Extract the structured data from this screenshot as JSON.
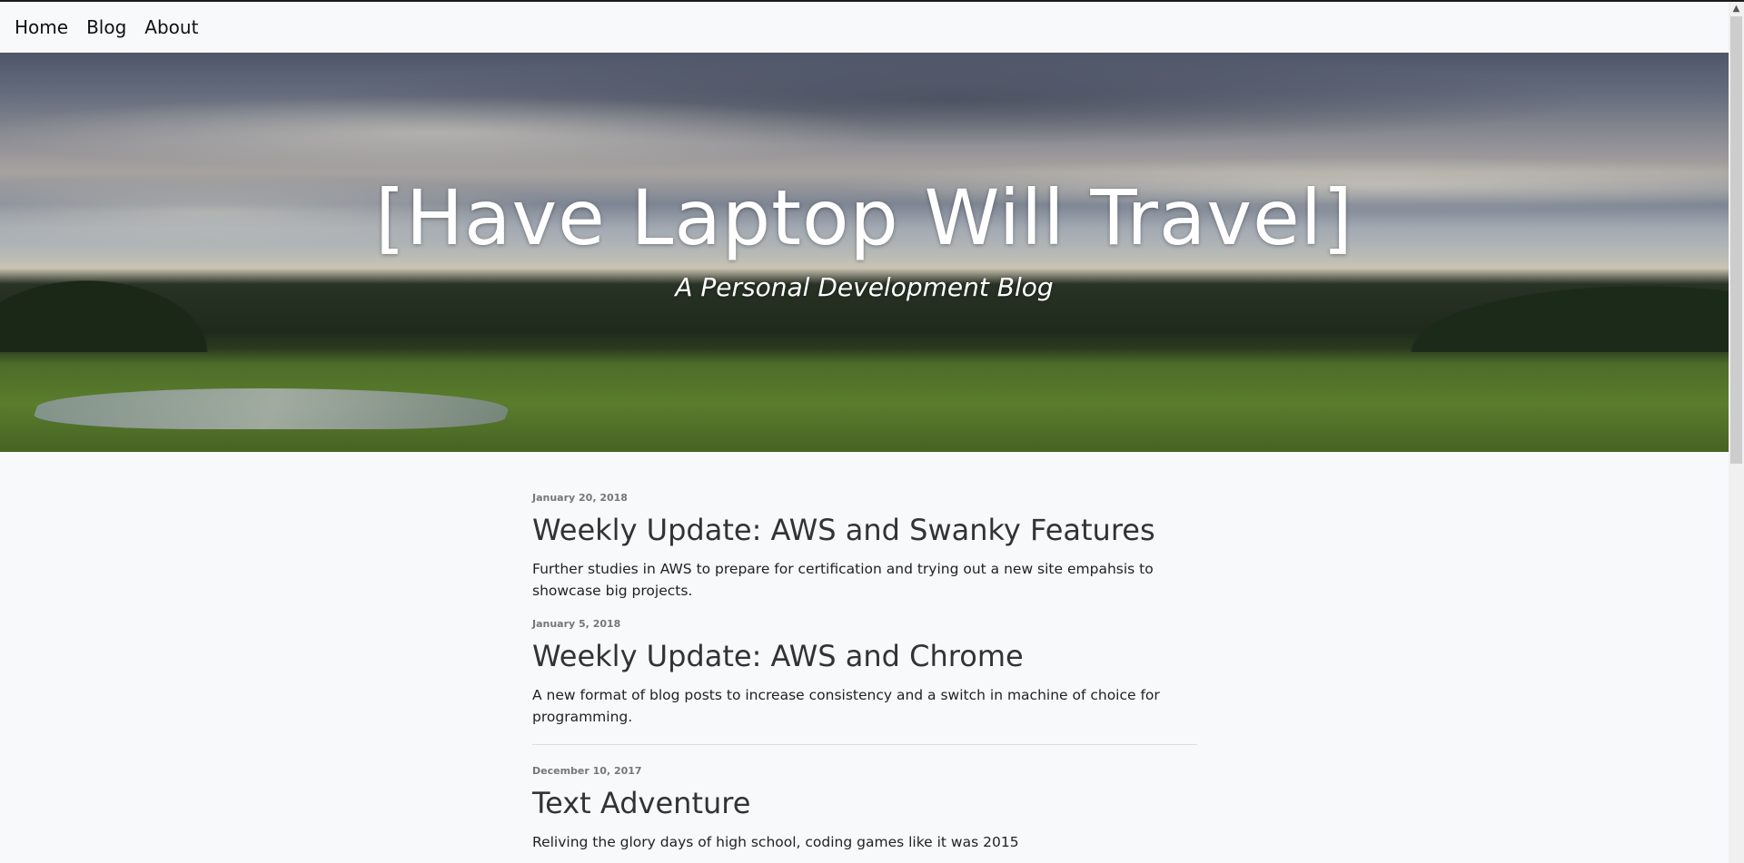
{
  "nav": {
    "items": [
      {
        "label": "Home"
      },
      {
        "label": "Blog"
      },
      {
        "label": "About"
      }
    ]
  },
  "hero": {
    "title": "[Have Laptop Will Travel]",
    "subtitle": "A Personal Development Blog"
  },
  "posts": [
    {
      "date": "January 20, 2018",
      "title": "Weekly Update: AWS and Swanky Features",
      "excerpt": "Further studies in AWS to prepare for certification and trying out a new site empahsis to showcase big projects."
    },
    {
      "date": "January 5, 2018",
      "title": "Weekly Update: AWS and Chrome",
      "excerpt": "A new format of blog posts to increase consistency and a switch in machine of choice for programming."
    },
    {
      "date": "December 10, 2017",
      "title": "Text Adventure",
      "excerpt": "Reliving the glory days of high school, coding games like it was 2015"
    }
  ],
  "scrollbar": {
    "up_icon": "chevron-up-icon",
    "up_glyph": "▲"
  }
}
